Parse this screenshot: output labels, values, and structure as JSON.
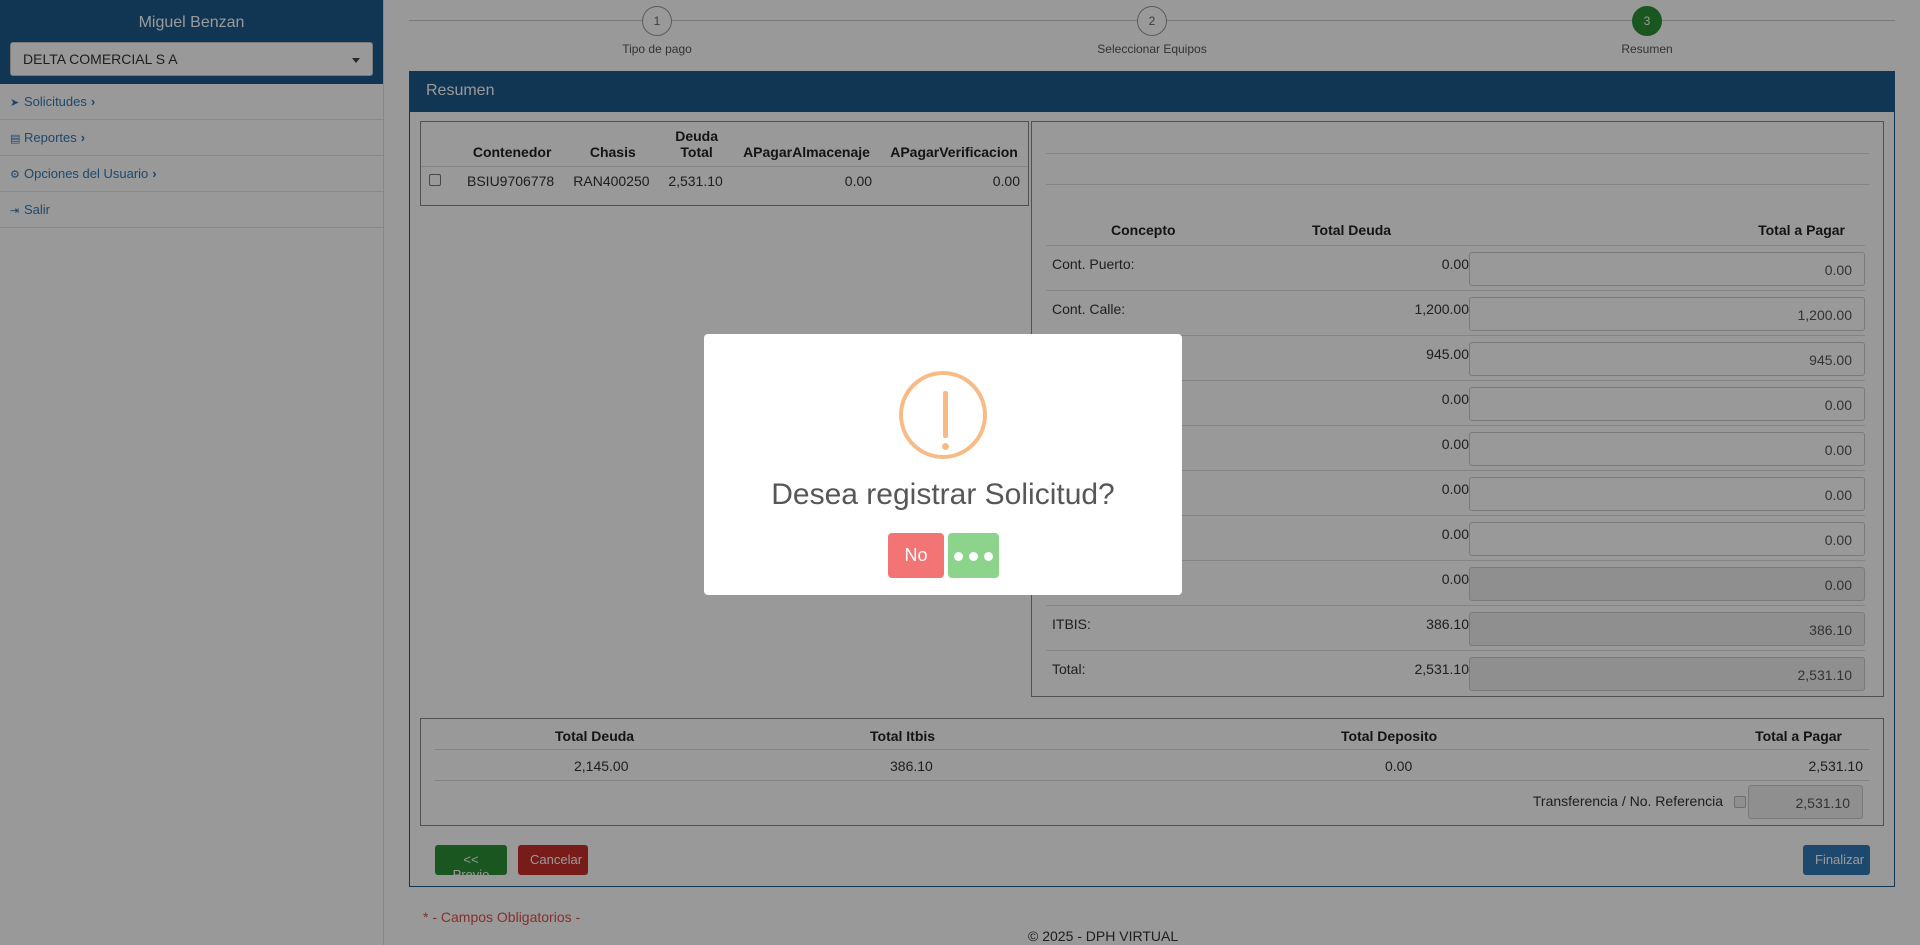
{
  "sidebar": {
    "user_name": "Miguel Benzan",
    "company_select": "DELTA COMERCIAL S A",
    "items": [
      {
        "icon": "send-icon",
        "label": "Solicitudes"
      },
      {
        "icon": "list-icon",
        "label": "Reportes"
      },
      {
        "icon": "gear-icon",
        "label": "Opciones del Usuario"
      },
      {
        "icon": "sign-out-icon",
        "label": "Salir"
      }
    ]
  },
  "stepper": {
    "steps": [
      {
        "number": "1",
        "label": "Tipo de pago"
      },
      {
        "number": "2",
        "label": "Seleccionar Equipos"
      },
      {
        "number": "3",
        "label": "Resumen"
      }
    ],
    "active_step": 3
  },
  "panel": {
    "title": "Resumen"
  },
  "containers": {
    "headers": {
      "contenedor": "Contenedor",
      "chasis": "Chasis",
      "deuda_line1": "Deuda",
      "deuda_line2": "Total",
      "almacenaje": "APagarAlmacenaje",
      "verificacion": "APagarVerificacion"
    },
    "rows": [
      {
        "contenedor": "BSIU9706778",
        "chasis": "RAN400250",
        "deuda": "2,531.10",
        "almacenaje": "0.00",
        "verificacion": "0.00"
      }
    ]
  },
  "conceptos": {
    "headers": {
      "concepto": "Concepto",
      "total_deuda": "Total Deuda",
      "total_pagar": "Total a Pagar"
    },
    "rows": [
      {
        "name": "Cont. Puerto:",
        "deuda": "0.00",
        "pagar": "0.00"
      },
      {
        "name": "Cont. Calle:",
        "deuda": "1,200.00",
        "pagar": "1,200.00"
      },
      {
        "name": "",
        "deuda": "945.00",
        "pagar": "945.00"
      },
      {
        "name": "",
        "deuda": "0.00",
        "pagar": "0.00"
      },
      {
        "name": "",
        "deuda": "0.00",
        "pagar": "0.00"
      },
      {
        "name": "",
        "deuda": "0.00",
        "pagar": "0.00"
      },
      {
        "name": "",
        "deuda": "0.00",
        "pagar": "0.00"
      },
      {
        "name": "",
        "deuda": "0.00",
        "pagar": "0.00"
      },
      {
        "name": "ITBIS:",
        "deuda": "386.10",
        "pagar": "386.10"
      },
      {
        "name": "Total:",
        "deuda": "2,531.10",
        "pagar": "2,531.10"
      }
    ]
  },
  "totals": {
    "headers": {
      "deuda": "Total Deuda",
      "itbis": "Total Itbis",
      "deposito": "Total Deposito",
      "pagar": "Total a Pagar"
    },
    "values": {
      "deuda": "2,145.00",
      "itbis": "386.10",
      "deposito": "0.00",
      "pagar": "2,531.10"
    },
    "transfer_label": "Transferencia / No. Referencia",
    "transfer_value": "2,531.10"
  },
  "buttons": {
    "prev": "<< Previo",
    "cancel": "Cancelar",
    "finish": "Finalizar"
  },
  "required_note": "* - Campos Obligatorios -",
  "footer": "© 2025 - DPH VIRTUAL",
  "modal": {
    "title": "Desea registrar Solicitud?",
    "no_label": "No",
    "icon": "warning-icon"
  },
  "colors": {
    "brand": "#1c5a8a",
    "success": "#2c8f35",
    "danger": "#c9302c",
    "warning": "#f8bb86",
    "modal_no": "#f27474",
    "modal_yes": "#8cd48c"
  }
}
